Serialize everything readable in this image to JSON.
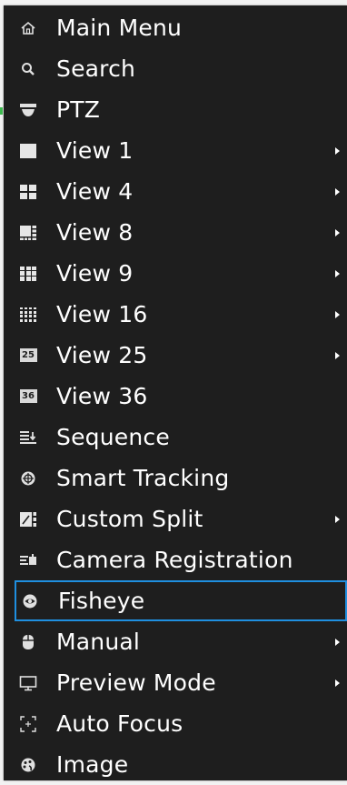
{
  "menu": {
    "items": [
      {
        "label": "Main Menu",
        "icon": "home-icon",
        "has_submenu": false
      },
      {
        "label": "Search",
        "icon": "search-icon",
        "has_submenu": false
      },
      {
        "label": "PTZ",
        "icon": "ptz-camera-icon",
        "has_submenu": false
      },
      {
        "label": "View 1",
        "icon": "view-1-icon",
        "has_submenu": true
      },
      {
        "label": "View 4",
        "icon": "view-4-icon",
        "has_submenu": true
      },
      {
        "label": "View 8",
        "icon": "view-8-icon",
        "has_submenu": true
      },
      {
        "label": "View 9",
        "icon": "view-9-icon",
        "has_submenu": true
      },
      {
        "label": "View 16",
        "icon": "view-16-icon",
        "has_submenu": true
      },
      {
        "label": "View 25",
        "icon": "view-25-icon",
        "icon_text": "25",
        "has_submenu": true
      },
      {
        "label": "View 36",
        "icon": "view-36-icon",
        "icon_text": "36",
        "has_submenu": false
      },
      {
        "label": "Sequence",
        "icon": "sequence-icon",
        "has_submenu": false
      },
      {
        "label": "Smart Tracking",
        "icon": "smart-tracking-icon",
        "has_submenu": false
      },
      {
        "label": "Custom Split",
        "icon": "custom-split-icon",
        "has_submenu": true
      },
      {
        "label": "Camera Registration",
        "icon": "camera-registration-icon",
        "has_submenu": false
      },
      {
        "label": "Fisheye",
        "icon": "fisheye-icon",
        "has_submenu": false,
        "selected": true
      },
      {
        "label": "Manual",
        "icon": "manual-icon",
        "has_submenu": true
      },
      {
        "label": "Preview Mode",
        "icon": "preview-mode-icon",
        "has_submenu": true
      },
      {
        "label": "Auto Focus",
        "icon": "auto-focus-icon",
        "has_submenu": false
      },
      {
        "label": "Image",
        "icon": "image-icon",
        "has_submenu": false
      }
    ]
  },
  "colors": {
    "menu_background": "#1e1e1e",
    "text": "#ffffff",
    "selection_border": "#1f8fe0"
  }
}
